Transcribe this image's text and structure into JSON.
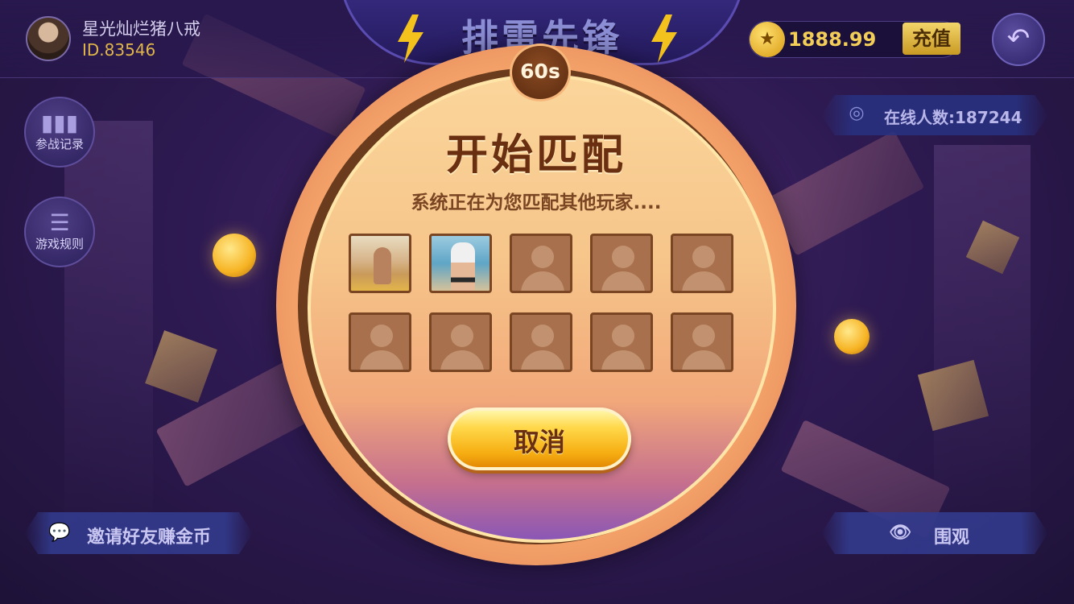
{
  "user": {
    "name": "星光灿烂猪八戒",
    "id": "ID.83546"
  },
  "header": {
    "title": "排雷先锋",
    "coins": "1888.99",
    "recharge_label": "充值",
    "back_icon": "back-arrow-icon"
  },
  "sidebar": {
    "items": [
      {
        "label": "参战记录",
        "icon": "bar-chart-icon"
      },
      {
        "label": "游戏规则",
        "icon": "list-icon"
      }
    ]
  },
  "online": {
    "label": "在线人数:187244"
  },
  "bottom": {
    "invite_label": "邀请好友赚金币",
    "watch_label": "围观"
  },
  "match": {
    "timer": "60s",
    "title": "开始匹配",
    "subtitle": "系统正在为您匹配其他玩家....",
    "cancel_label": "取消",
    "slots": [
      "photo",
      "photo",
      "empty",
      "empty",
      "empty",
      "empty",
      "empty",
      "empty",
      "empty",
      "empty"
    ]
  },
  "colors": {
    "accent": "#f6ae12",
    "modal_ring": "#f7a86d",
    "title_text": "#6a2f10",
    "background": "#2e1a52"
  }
}
